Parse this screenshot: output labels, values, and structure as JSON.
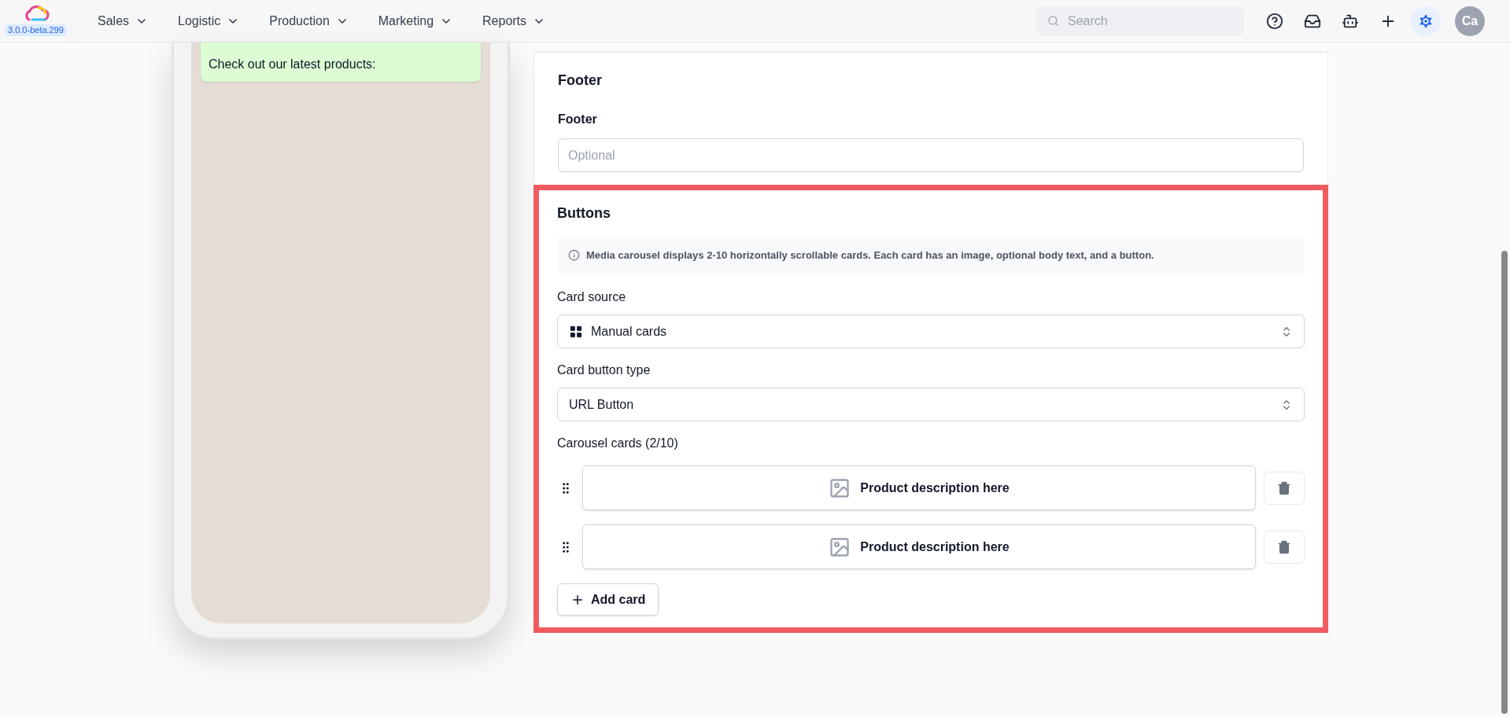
{
  "topbar": {
    "version": "3.0.0-beta.299",
    "nav": [
      {
        "label": "Sales"
      },
      {
        "label": "Logistic"
      },
      {
        "label": "Production"
      },
      {
        "label": "Marketing"
      },
      {
        "label": "Reports"
      }
    ],
    "search": {
      "placeholder": "Search"
    },
    "avatar": "Ca"
  },
  "preview": {
    "message": "Check out our latest products:"
  },
  "footer_section": {
    "title": "Footer",
    "field_label": "Footer",
    "placeholder": "Optional"
  },
  "buttons_section": {
    "title": "Buttons",
    "info": "Media carousel displays 2-10 horizontally scrollable cards. Each card has an image, optional body text, and a button.",
    "card_source": {
      "label": "Card source",
      "value": "Manual cards"
    },
    "card_button_type": {
      "label": "Card button type",
      "value": "URL Button"
    },
    "cards_label": "Carousel cards (2/10)",
    "cards": [
      {
        "text": "Product description here"
      },
      {
        "text": "Product description here"
      }
    ],
    "add_button": "Add card"
  }
}
